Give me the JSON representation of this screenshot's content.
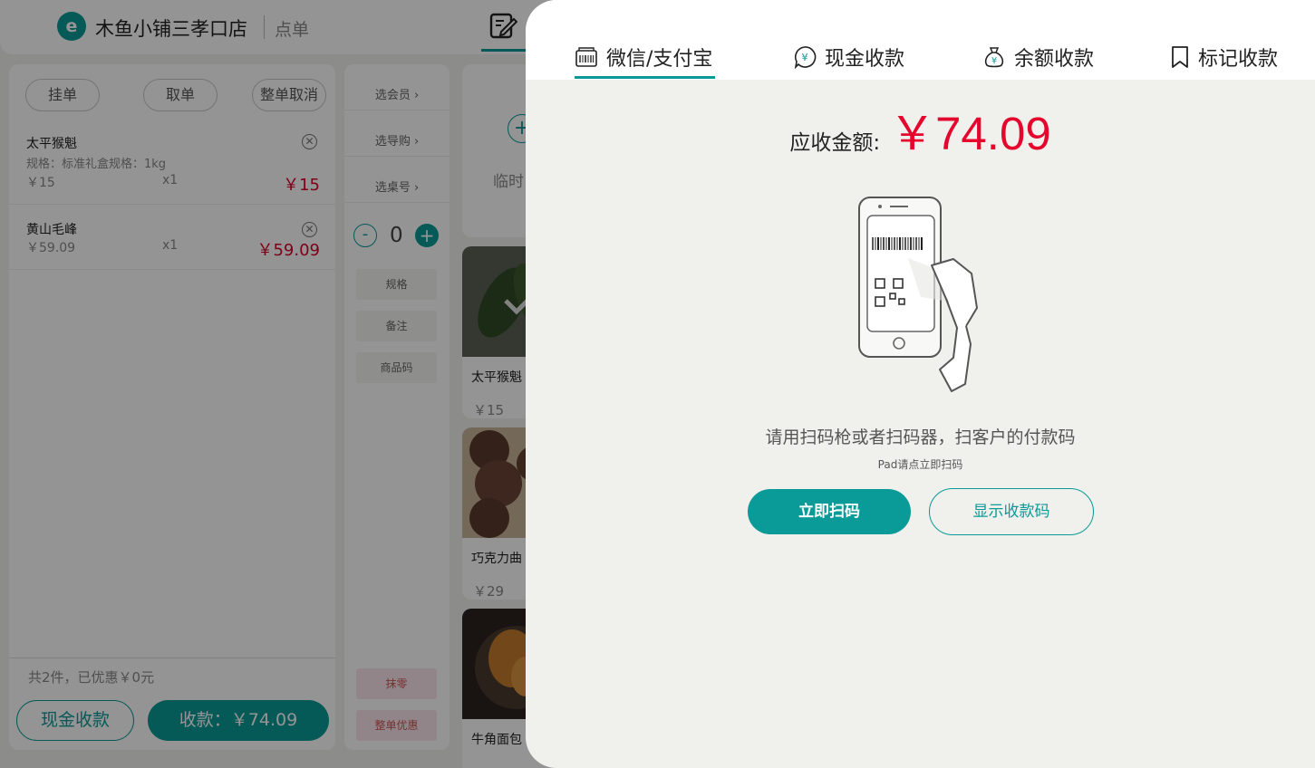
{
  "header": {
    "logo_glyph": "e",
    "store_name": "木鱼小铺三孝口店",
    "module": "点单"
  },
  "cart": {
    "actions": [
      "挂单",
      "取单",
      "整单取消"
    ],
    "items": [
      {
        "name": "太平猴魁",
        "spec": "规格：标准礼盒规格：1kg",
        "unit_price": "￥15",
        "qty": "x1",
        "line_total": "￥15"
      },
      {
        "name": "黄山毛峰",
        "spec": "",
        "unit_price": "￥59.09",
        "qty": "x1",
        "line_total": "￥59.09"
      }
    ],
    "remove_glyph": "✕",
    "summary": "共2件，已优惠￥0元",
    "cash_button": "现金收款",
    "pay_button": "收款：￥74.09"
  },
  "options": {
    "selectors": [
      "选会员",
      "选导购",
      "选桌号"
    ],
    "stepper": {
      "minus": "-",
      "value": "0",
      "plus": "+"
    },
    "buttons": [
      "规格",
      "备注",
      "商品码"
    ],
    "bottom_buttons": [
      "抹零",
      "整单优惠"
    ]
  },
  "products": {
    "temp_plus": "+",
    "temp_label": "临时",
    "items": [
      {
        "name": "太平猴魁",
        "price": "￥15"
      },
      {
        "name": "巧克力曲",
        "price": "￥29"
      },
      {
        "name": "牛角面包",
        "price": ""
      }
    ]
  },
  "payment": {
    "tabs": [
      "微信/支付宝",
      "现金收款",
      "余额收款",
      "标记收款"
    ],
    "active_tab": 0,
    "amount_label": "应收金额:",
    "amount_value": "￥74.09",
    "hint": "请用扫码枪或者扫码器，扫客户的付款码",
    "sub_hint": "Pad请点立即扫码",
    "scan_button": "立即扫码",
    "show_qr_button": "显示收款码"
  },
  "colors": {
    "accent": "#0a9a97",
    "price_red": "#e4062d",
    "panel_bg": "#f0f0ec"
  }
}
